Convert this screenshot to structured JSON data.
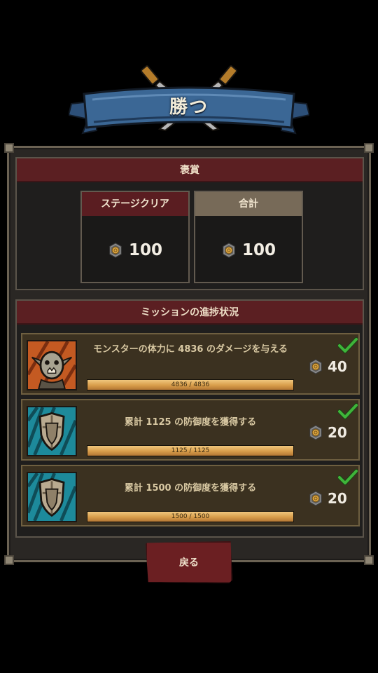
{
  "banner": {
    "title": "勝つ"
  },
  "rewards": {
    "section_title": "褒賞",
    "stage_clear": {
      "label": "ステージクリア",
      "amount": "100"
    },
    "total": {
      "label": "合計",
      "amount": "100"
    }
  },
  "missions": {
    "section_title": "ミッションの進捗状況",
    "items": [
      {
        "text": "モンスターの体力に 4836 のダメージを与える",
        "progress_text": "4836 / 4836",
        "progress": 1.0,
        "reward": "40",
        "completed": true,
        "icon": "goblin-portrait-icon"
      },
      {
        "text": "累計 1125 の防御度を獲得する",
        "progress_text": "1125 / 1125",
        "progress": 1.0,
        "reward": "20",
        "completed": true,
        "icon": "shield-portrait-icon"
      },
      {
        "text": "累計 1500 の防御度を獲得する",
        "progress_text": "1500 / 1500",
        "progress": 1.0,
        "reward": "20",
        "completed": true,
        "icon": "shield-portrait-icon"
      }
    ]
  },
  "back_button": {
    "label": "戻る"
  },
  "colors": {
    "section_header": "#5b1f22",
    "banner": "#3b6795",
    "check": "#3fb43a",
    "bar_fill": "#e0a855"
  }
}
